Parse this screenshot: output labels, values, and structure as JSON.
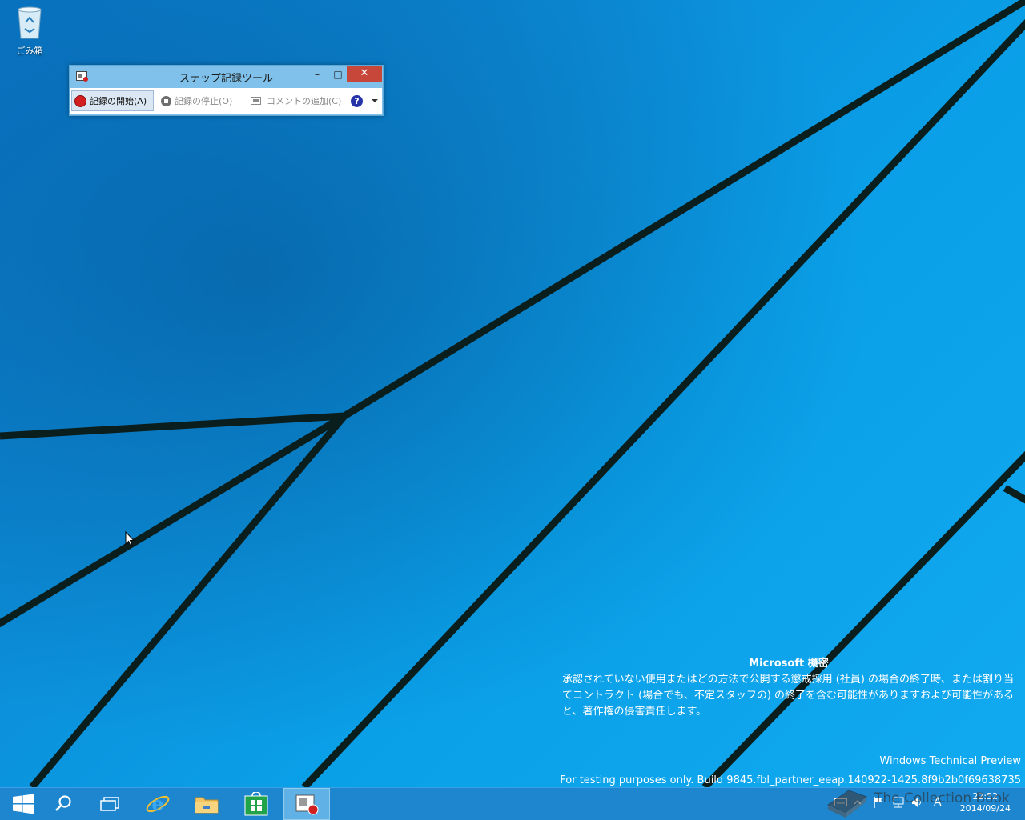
{
  "desktop": {
    "recycle_bin_label": "ごみ箱"
  },
  "steps_recorder": {
    "title": "ステップ記録ツール",
    "minimize": "–",
    "maximize": "□",
    "close": "✕",
    "toolbar": {
      "start_label": "記録の開始(A)",
      "stop_label": "記録の停止(O)",
      "comment_label": "コメントの追加(C)",
      "help_label": "?"
    }
  },
  "watermark": {
    "title": "Microsoft 機密",
    "body": "承認されていない使用またはどの方法で公開する懲戒採用 (社員) の場合の終了時、または割り当てコントラクト (場合でも、不定スタッフの) の終了を含む可能性がありますおよび可能性があると、著作権の侵害責任します。",
    "edition": "Windows Technical Preview",
    "build": "For testing purposes only. Build 9845.fbl_partner_eeap.140922-1425.8f9b2b0f69638735"
  },
  "taskbar": {
    "items": [
      {
        "name": "start",
        "icon": "windows-logo-icon"
      },
      {
        "name": "search",
        "icon": "search-icon"
      },
      {
        "name": "task-view",
        "icon": "task-view-icon"
      },
      {
        "name": "internet-explorer",
        "icon": "ie-icon"
      },
      {
        "name": "file-explorer",
        "icon": "folder-icon"
      },
      {
        "name": "store",
        "icon": "store-icon"
      },
      {
        "name": "steps-recorder",
        "icon": "steps-recorder-icon",
        "active": true
      }
    ],
    "tray": {
      "ime_label": "A",
      "time": "22:52",
      "date": "2014/09/24"
    }
  },
  "overlay_logo": {
    "text": "The Collection Book"
  },
  "colors": {
    "desktop_blue": "#0c8ed9",
    "taskbar": "#1d86cf",
    "window_frame": "#7fc1ea",
    "close_red": "#c7483b",
    "record_red": "#d21f1f"
  }
}
